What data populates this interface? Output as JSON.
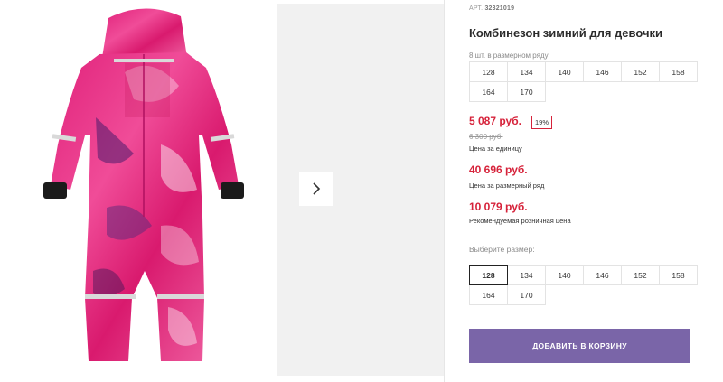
{
  "product": {
    "sku_label": "АРТ.",
    "sku": "32321019",
    "title": "Комбинезон зимний для девочки",
    "image_icon": "product-photo-snowsuit"
  },
  "gallery": {
    "next_icon": "chevron-right-icon"
  },
  "pack": {
    "label": "8 шт. в размерном ряду",
    "sizes": [
      "128",
      "134",
      "140",
      "146",
      "152",
      "158",
      "164",
      "170"
    ]
  },
  "pricing": {
    "unit_price": "5 087 руб.",
    "discount": "19%",
    "old_price": "6 300 руб.",
    "unit_caption": "Цена за единицу",
    "pack_price": "40 696 руб.",
    "pack_caption": "Цена за размерный ряд",
    "rrp_price": "10 079 руб.",
    "rrp_caption": "Рекомендуемая розничная цена",
    "price_color": "#d6223a"
  },
  "size_select": {
    "label": "Выберите размер:",
    "sizes": [
      "128",
      "134",
      "140",
      "146",
      "152",
      "158",
      "164",
      "170"
    ],
    "selected": "128"
  },
  "cart": {
    "button_label": "ДОБАВИТЬ В КОРЗИНУ",
    "button_color": "#7a65a8"
  }
}
